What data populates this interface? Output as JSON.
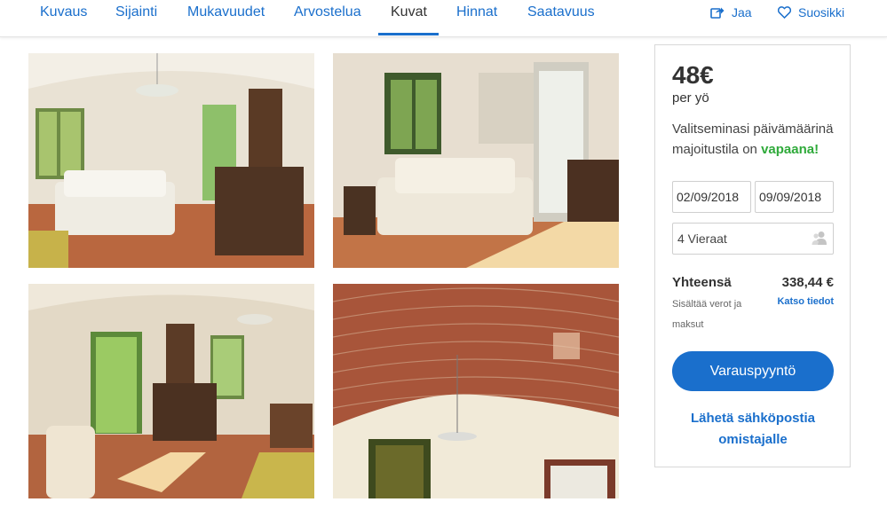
{
  "nav": {
    "tabs": [
      {
        "label": "Kuvaus"
      },
      {
        "label": "Sijainti"
      },
      {
        "label": "Mukavuudet"
      },
      {
        "label": "Arvostelua"
      },
      {
        "label": "Kuvat"
      },
      {
        "label": "Hinnat"
      },
      {
        "label": "Saatavuus"
      }
    ],
    "active_tab": "Kuvat",
    "share_label": "Jaa",
    "favorite_label": "Suosikki"
  },
  "photos": [
    {
      "alt_icon": "living-room-photo"
    },
    {
      "alt_icon": "sofa-room-photo"
    },
    {
      "alt_icon": "room-with-dresser-photo"
    },
    {
      "alt_icon": "brick-vaulted-ceiling-photo"
    }
  ],
  "booking": {
    "price": "48€",
    "per_night": "per yö",
    "availability_prefix": "Valitseminasi päivämäärinä majoitustila on",
    "availability_status": "vapaana!",
    "checkin": "02/09/2018",
    "checkout": "09/09/2018",
    "guests": "4 Vieraat",
    "total_label": "Yhteensä",
    "total_value": "338,44 €",
    "tax_note": "Sisältää verot ja maksut",
    "details_link": "Katso tiedot",
    "request_button": "Varauspyyntö",
    "email_link": "Lähetä sähköpostia omistajalle"
  },
  "colors": {
    "accent": "#1a6fcc",
    "available": "#2faa3a"
  }
}
